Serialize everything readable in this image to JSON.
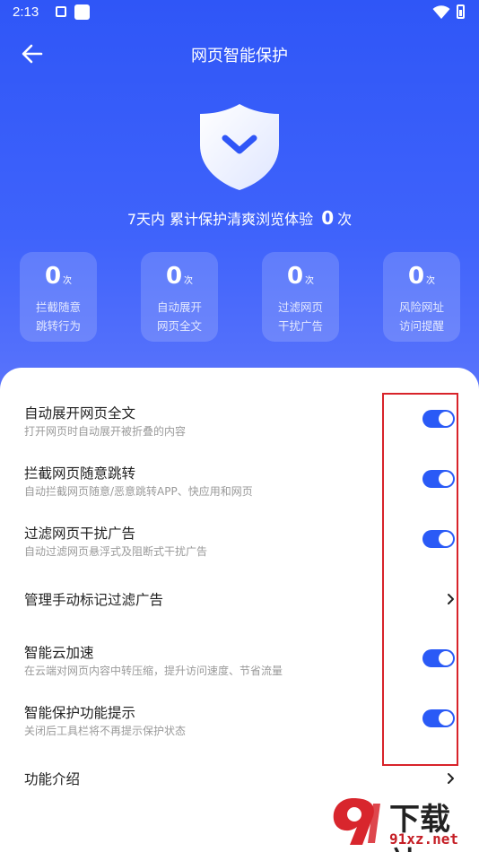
{
  "status_bar": {
    "time": "2:13",
    "icons": [
      "a-icon",
      "square-icon",
      "wifi-icon",
      "battery-icon"
    ]
  },
  "header": {
    "title": "网页智能保护",
    "back_icon": "arrow-left-icon"
  },
  "summary": {
    "prefix": "7天内 累计保护清爽浏览体验",
    "count": "0",
    "unit": "次"
  },
  "stats": [
    {
      "value": "0",
      "unit": "次",
      "line1": "拦截随意",
      "line2": "跳转行为"
    },
    {
      "value": "0",
      "unit": "次",
      "line1": "自动展开",
      "line2": "网页全文"
    },
    {
      "value": "0",
      "unit": "次",
      "line1": "过滤网页",
      "line2": "干扰广告"
    },
    {
      "value": "0",
      "unit": "次",
      "line1": "风险网址",
      "line2": "访问提醒"
    }
  ],
  "settings": [
    {
      "title": "自动展开网页全文",
      "desc": "打开网页时自动展开被折叠的内容",
      "control": "toggle",
      "on": true
    },
    {
      "title": "拦截网页随意跳转",
      "desc": "自动拦截网页随意/恶意跳转APP、快应用和网页",
      "control": "toggle",
      "on": true
    },
    {
      "title": "过滤网页干扰广告",
      "desc": "自动过滤网页悬浮式及阻断式干扰广告",
      "control": "toggle",
      "on": true
    },
    {
      "title": "管理手动标记过滤广告",
      "desc": "",
      "control": "chevron"
    },
    {
      "title": "智能云加速",
      "desc": "在云端对网页内容中转压缩，提升访问速度、节省流量",
      "control": "toggle",
      "on": true
    },
    {
      "title": "智能保护功能提示",
      "desc": "关闭后工具栏将不再提示保护状态",
      "control": "toggle",
      "on": true
    },
    {
      "title": "功能介绍",
      "desc": "",
      "control": "chevron"
    }
  ],
  "watermark": {
    "brand": "下载站",
    "url": "91xz.net"
  },
  "colors": {
    "accent": "#2a5af6",
    "header_bg": "#2f56f7",
    "highlight": "#d8232a"
  }
}
